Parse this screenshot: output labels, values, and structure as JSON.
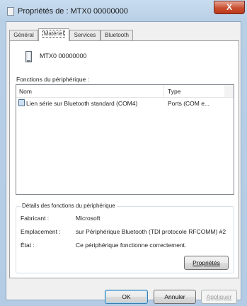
{
  "window": {
    "title": "Propriétés de : MTX0 00000000",
    "close_label": "X"
  },
  "tabs": [
    {
      "label": "Général"
    },
    {
      "label": "Matériel"
    },
    {
      "label": "Services"
    },
    {
      "label": "Bluetooth"
    }
  ],
  "device": {
    "name": "MTX0 00000000"
  },
  "functions": {
    "label": "Fonctions du périphérique :",
    "columns": {
      "name": "Nom",
      "type": "Type"
    },
    "rows": [
      {
        "name": "Lien série sur Bluetooth standard (COM4)",
        "type": "Ports (COM e..."
      }
    ]
  },
  "details": {
    "title": "Détails des fonctions du périphérique",
    "manufacturer_label": "Fabricant :",
    "manufacturer_value": "Microsoft",
    "location_label": "Emplacement :",
    "location_value": "sur Périphérique Bluetooth (TDI protocole RFCOMM) #2",
    "status_label": "État :",
    "status_value": "Ce périphérique fonctionne correctement.",
    "properties_button": "Propriétés"
  },
  "footer": {
    "ok": "OK",
    "cancel": "Annuler",
    "apply": "Appliquer"
  }
}
